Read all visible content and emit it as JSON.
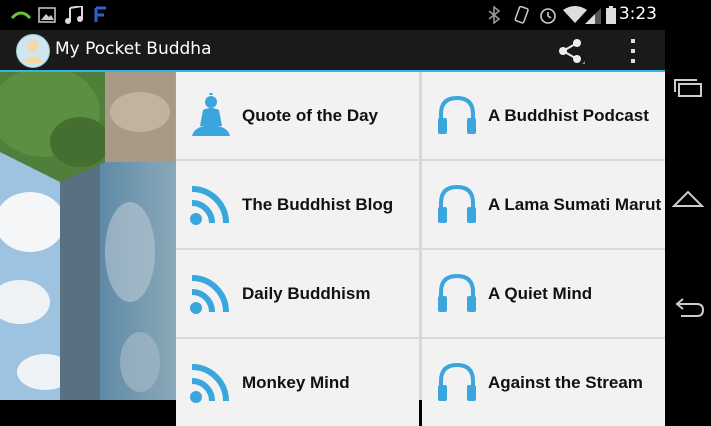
{
  "status_bar": {
    "time": "3:23"
  },
  "app": {
    "title": "My Pocket Buddha"
  },
  "menu": [
    {
      "label": "Quote of the Day",
      "icon": "buddha-icon"
    },
    {
      "label": "A Buddhist Podcast",
      "icon": "headphones-icon"
    },
    {
      "label": "The Buddhist Blog",
      "icon": "rss-icon"
    },
    {
      "label": "A Lama Sumati Marut",
      "icon": "headphones-icon"
    },
    {
      "label": "Daily Buddhism",
      "icon": "rss-icon"
    },
    {
      "label": "A Quiet Mind",
      "icon": "headphones-icon"
    },
    {
      "label": "Monkey Mind",
      "icon": "rss-icon"
    },
    {
      "label": "Against the Stream",
      "icon": "headphones-icon"
    }
  ],
  "colors": {
    "accent": "#33b5e5",
    "icon_blue": "#3aa6dd"
  }
}
